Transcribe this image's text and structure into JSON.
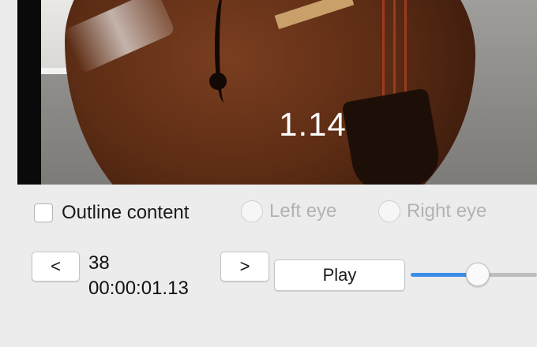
{
  "video": {
    "overlay_text": "1.14"
  },
  "options": {
    "outline_label": "Outline content",
    "outline_checked": false,
    "left_eye_label": "Left eye",
    "right_eye_label": "Right eye"
  },
  "playback": {
    "prev_label": "<",
    "next_label": ">",
    "frame_number": "38",
    "timecode": "00:00:01.13",
    "play_label": "Play",
    "slider_level": 0.53,
    "accent_color": "#3b8ee8"
  }
}
